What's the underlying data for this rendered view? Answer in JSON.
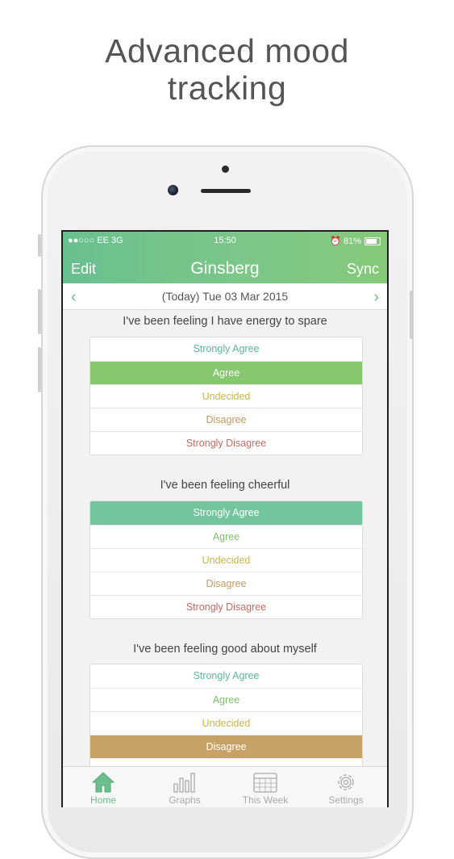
{
  "headline": {
    "line1": "Advanced mood",
    "line2": "tracking"
  },
  "status_bar": {
    "carrier": "●●○○○ EE   3G",
    "time": "15:50",
    "battery": "⏰ 81%"
  },
  "nav": {
    "edit": "Edit",
    "title": "Ginsberg",
    "sync": "Sync"
  },
  "date_bar": {
    "prev": "‹",
    "next": "›",
    "date": "(Today)  Tue 03 Mar 2015"
  },
  "questions": [
    {
      "text": "I've been feeling I have energy to spare",
      "options": [
        "Strongly Agree",
        "Agree",
        "Undecided",
        "Disagree",
        "Strongly Disagree"
      ],
      "selected": "Agree"
    },
    {
      "text": "I've been feeling cheerful",
      "options": [
        "Strongly Agree",
        "Agree",
        "Undecided",
        "Disagree",
        "Strongly Disagree"
      ],
      "selected": "Strongly Agree"
    },
    {
      "text": "I've been feeling good about myself",
      "options": [
        "Strongly Agree",
        "Agree",
        "Undecided",
        "Disagree"
      ],
      "selected": "Disagree"
    }
  ],
  "tabs": [
    {
      "label": "Home",
      "icon": "home-icon",
      "active": true
    },
    {
      "label": "Graphs",
      "icon": "bar-chart-icon",
      "active": false
    },
    {
      "label": "This Week",
      "icon": "calendar-icon",
      "active": false
    },
    {
      "label": "Settings",
      "icon": "gear-icon",
      "active": false
    }
  ],
  "colors": {
    "accent": "#6bbf8c",
    "strongly_agree": "#5bb896",
    "agree": "#7dc06a",
    "undecided": "#c5b84e",
    "disagree": "#c49a5e",
    "strongly_disagree": "#c66a62"
  }
}
